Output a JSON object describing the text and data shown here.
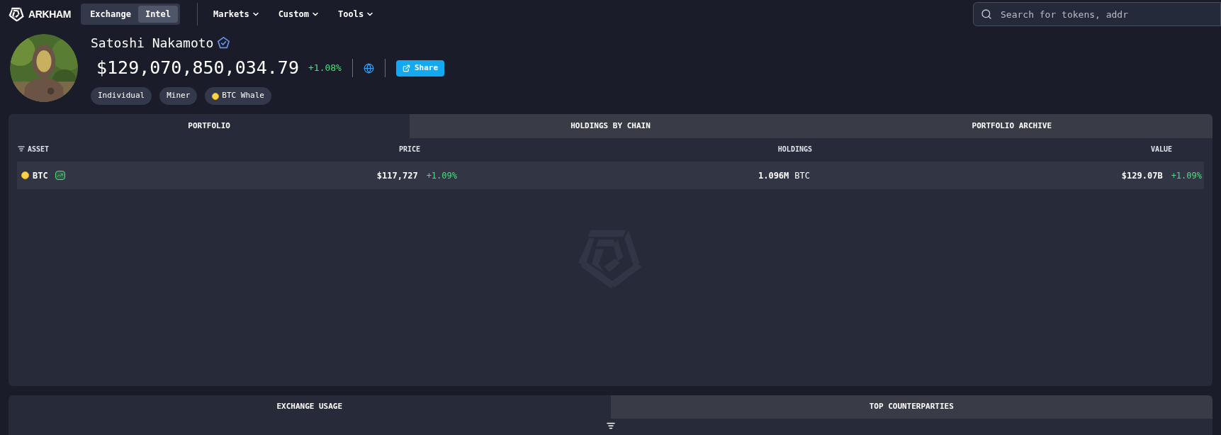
{
  "nav": {
    "brand": "ARKHAM",
    "modes": [
      {
        "label": "Exchange",
        "selected": false
      },
      {
        "label": "Intel",
        "selected": true
      }
    ],
    "menus": [
      {
        "label": "Markets"
      },
      {
        "label": "Custom"
      },
      {
        "label": "Tools"
      }
    ],
    "search": {
      "placeholder": "Search for tokens, addr"
    }
  },
  "entity": {
    "name": "Satoshi Nakamoto",
    "verified": true,
    "balance": "$129,070,850,034.79",
    "change": "+1.08%",
    "share": "Share",
    "tags": [
      {
        "label": "Individual",
        "coin": false
      },
      {
        "label": "Miner",
        "coin": false
      },
      {
        "label": "BTC Whale",
        "coin": true
      }
    ]
  },
  "portfolio": {
    "tabs": [
      {
        "label": "PORTFOLIO",
        "selected": true
      },
      {
        "label": "HOLDINGS BY CHAIN",
        "selected": false
      },
      {
        "label": "PORTFOLIO ARCHIVE",
        "selected": false
      }
    ],
    "columns": [
      "ASSET",
      "PRICE",
      "HOLDINGS",
      "VALUE"
    ],
    "rows": [
      {
        "asset": "BTC",
        "price": "$117,727",
        "price_change": "+1.09%",
        "holdings": "1.096M",
        "holdings_unit": "BTC",
        "value": "$129.07B",
        "value_change": "+1.09%"
      }
    ]
  },
  "bottom": {
    "tabs": [
      {
        "label": "EXCHANGE USAGE",
        "selected": true
      },
      {
        "label": "TOP COUNTERPARTIES",
        "selected": false
      }
    ]
  }
}
